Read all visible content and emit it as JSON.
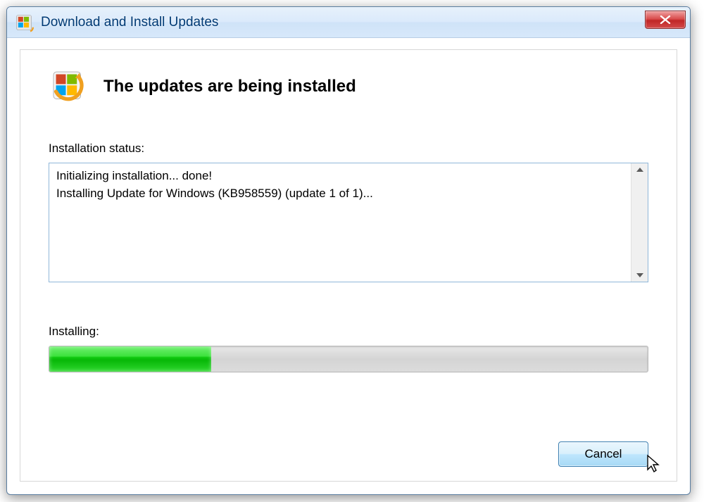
{
  "titlebar": {
    "title": "Download and Install Updates"
  },
  "header": {
    "heading": "The updates are being installed"
  },
  "status": {
    "label": "Installation status:",
    "lines": "Initializing installation... done!\nInstalling Update for Windows (KB958559) (update 1 of 1)... "
  },
  "progress": {
    "label": "Installing:",
    "percent": 27
  },
  "buttons": {
    "cancel": "Cancel"
  }
}
